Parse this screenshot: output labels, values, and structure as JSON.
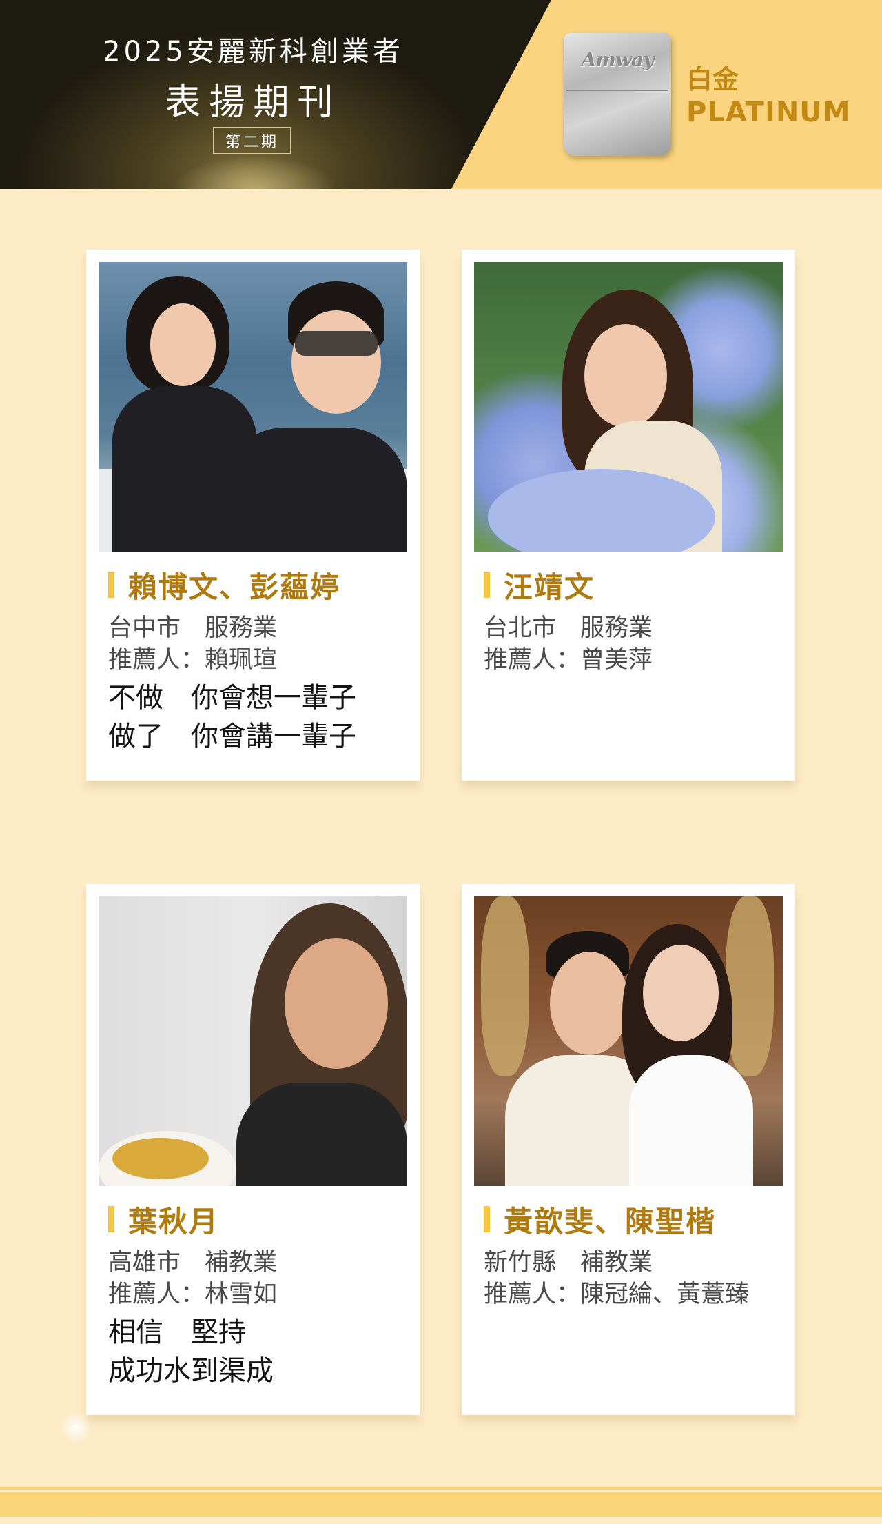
{
  "header": {
    "title_line1": "2025安麗新科創業者",
    "title_line2": "表揚期刊",
    "issue": "第二期",
    "badge_logo": "Amway",
    "level_zh": "白金",
    "level_en": "PLATINUM"
  },
  "cards": [
    {
      "name": "賴博文、彭蘊婷",
      "location": "台中市　服務業",
      "referrer": "推薦人：賴珮瑄",
      "quote_line1": "不做　你會想一輩子",
      "quote_line2": "做了　你會講一輩子"
    },
    {
      "name": "汪靖文",
      "location": "台北市　服務業",
      "referrer": "推薦人：曾美萍",
      "quote_line1": "",
      "quote_line2": ""
    },
    {
      "name": "葉秋月",
      "location": "高雄市　補教業",
      "referrer": "推薦人：林雪如",
      "quote_line1": "相信　堅持",
      "quote_line2": "成功水到渠成"
    },
    {
      "name": "黃歆斐、陳聖楷",
      "location": "新竹縣　補教業",
      "referrer": "推薦人：陳冠綸、黃薏臻",
      "quote_line1": "",
      "quote_line2": ""
    }
  ],
  "colors": {
    "background": "#fdebc6",
    "accent_gold": "#b07a0e",
    "name_bar": "#f5c441",
    "header_gold": "#fbd481"
  }
}
